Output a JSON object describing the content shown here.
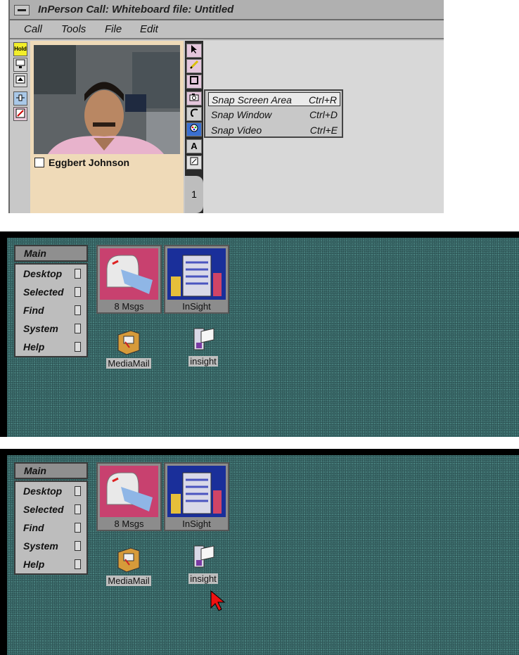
{
  "inperson": {
    "title": "InPerson Call: Whiteboard file: Untitled",
    "menus": [
      "Call",
      "Tools",
      "File",
      "Edit"
    ],
    "hold_label": "Hold",
    "participant": "Eggbert Johnson",
    "page_number": "1",
    "snap_menu": [
      {
        "label": "Snap Screen Area",
        "shortcut": "Ctrl+R"
      },
      {
        "label": "Snap Window",
        "shortcut": "Ctrl+D"
      },
      {
        "label": "Snap Video",
        "shortcut": "Ctrl+E"
      }
    ],
    "text_tool": "A"
  },
  "desktop": {
    "main_menu": {
      "header": "Main",
      "items": [
        "Desktop",
        "Selected",
        "Find",
        "System",
        "Help"
      ]
    },
    "tiles": [
      {
        "label": "8 Msgs"
      },
      {
        "label": "InSight"
      }
    ],
    "icons": [
      {
        "label": "MediaMail"
      },
      {
        "label": "insight"
      }
    ]
  }
}
